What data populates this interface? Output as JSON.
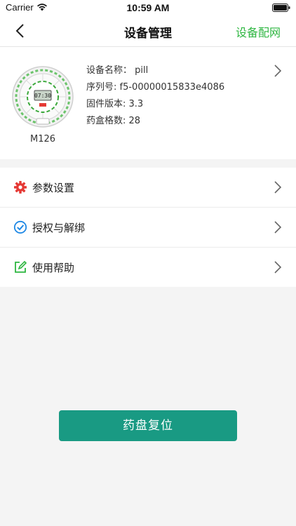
{
  "status_bar": {
    "carrier": "Carrier",
    "time": "10:59 AM"
  },
  "nav": {
    "title": "设备管理",
    "right_action": "设备配网"
  },
  "device": {
    "model": "M126",
    "name_label": "设备名称：",
    "name_value": "pill",
    "serial_label": "序列号: ",
    "serial_value": "f5-00000015833e4086",
    "firmware_label": "固件版本: ",
    "firmware_value": "3.3",
    "slots_label": "药盒格数: ",
    "slots_value": "28",
    "display_text": "07:30"
  },
  "menu": [
    {
      "label": "参数设置",
      "icon": "gear-icon",
      "color": "#e53935"
    },
    {
      "label": "授权与解绑",
      "icon": "check-circle-icon",
      "color": "#1e88e5"
    },
    {
      "label": "使用帮助",
      "icon": "edit-icon",
      "color": "#2db640"
    }
  ],
  "reset_button": {
    "label": "药盘复位",
    "color": "#199a83"
  },
  "colors": {
    "accent_green": "#2db640",
    "button_teal": "#199a83"
  }
}
